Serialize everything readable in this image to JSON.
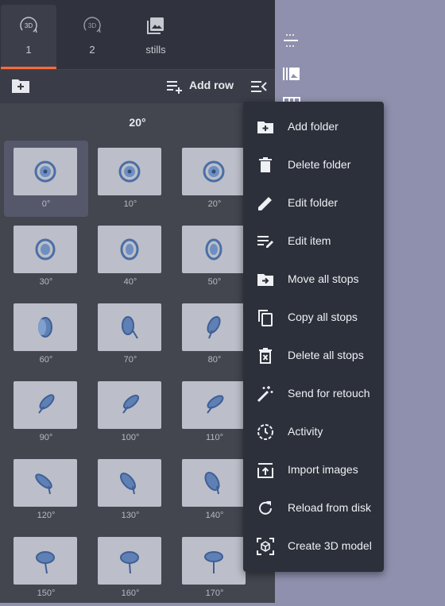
{
  "tabs": [
    {
      "badge": "3D",
      "label": "1",
      "icon": "3d-rotate-icon",
      "active": true
    },
    {
      "badge": "3D",
      "label": "2",
      "icon": "3d-rotate-icon",
      "active": false
    },
    {
      "badge": "",
      "label": "stills",
      "icon": "photo-library-icon",
      "active": false
    }
  ],
  "toolbar": {
    "add_row_label": "Add row"
  },
  "folder": {
    "title": "20°"
  },
  "thumbnails": [
    "0°",
    "10°",
    "20°",
    "30°",
    "40°",
    "50°",
    "60°",
    "70°",
    "80°",
    "90°",
    "100°",
    "110°",
    "120°",
    "130°",
    "140°",
    "150°",
    "160°",
    "170°"
  ],
  "menu": {
    "items": [
      {
        "label": "Add folder",
        "icon": "create-new-folder-icon"
      },
      {
        "label": "Delete folder",
        "icon": "trash-icon"
      },
      {
        "label": "Edit folder",
        "icon": "pencil-icon"
      },
      {
        "label": "Edit item",
        "icon": "edit-note-icon"
      },
      {
        "label": "Move all stops",
        "icon": "drive-file-move-icon"
      },
      {
        "label": "Copy all stops",
        "icon": "copy-icon"
      },
      {
        "label": "Delete all stops",
        "icon": "delete-sweep-icon"
      },
      {
        "label": "Send for retouch",
        "icon": "magic-wand-icon"
      },
      {
        "label": "Activity",
        "icon": "history-icon"
      },
      {
        "label": "Import images",
        "icon": "upload-icon"
      },
      {
        "label": "Reload from disk",
        "icon": "refresh-icon"
      },
      {
        "label": "Create 3D model",
        "icon": "3d-box-icon"
      }
    ]
  },
  "colors": {
    "accent": "#ff6a3a",
    "panel": "#43454f",
    "menu": "#2c303a"
  }
}
